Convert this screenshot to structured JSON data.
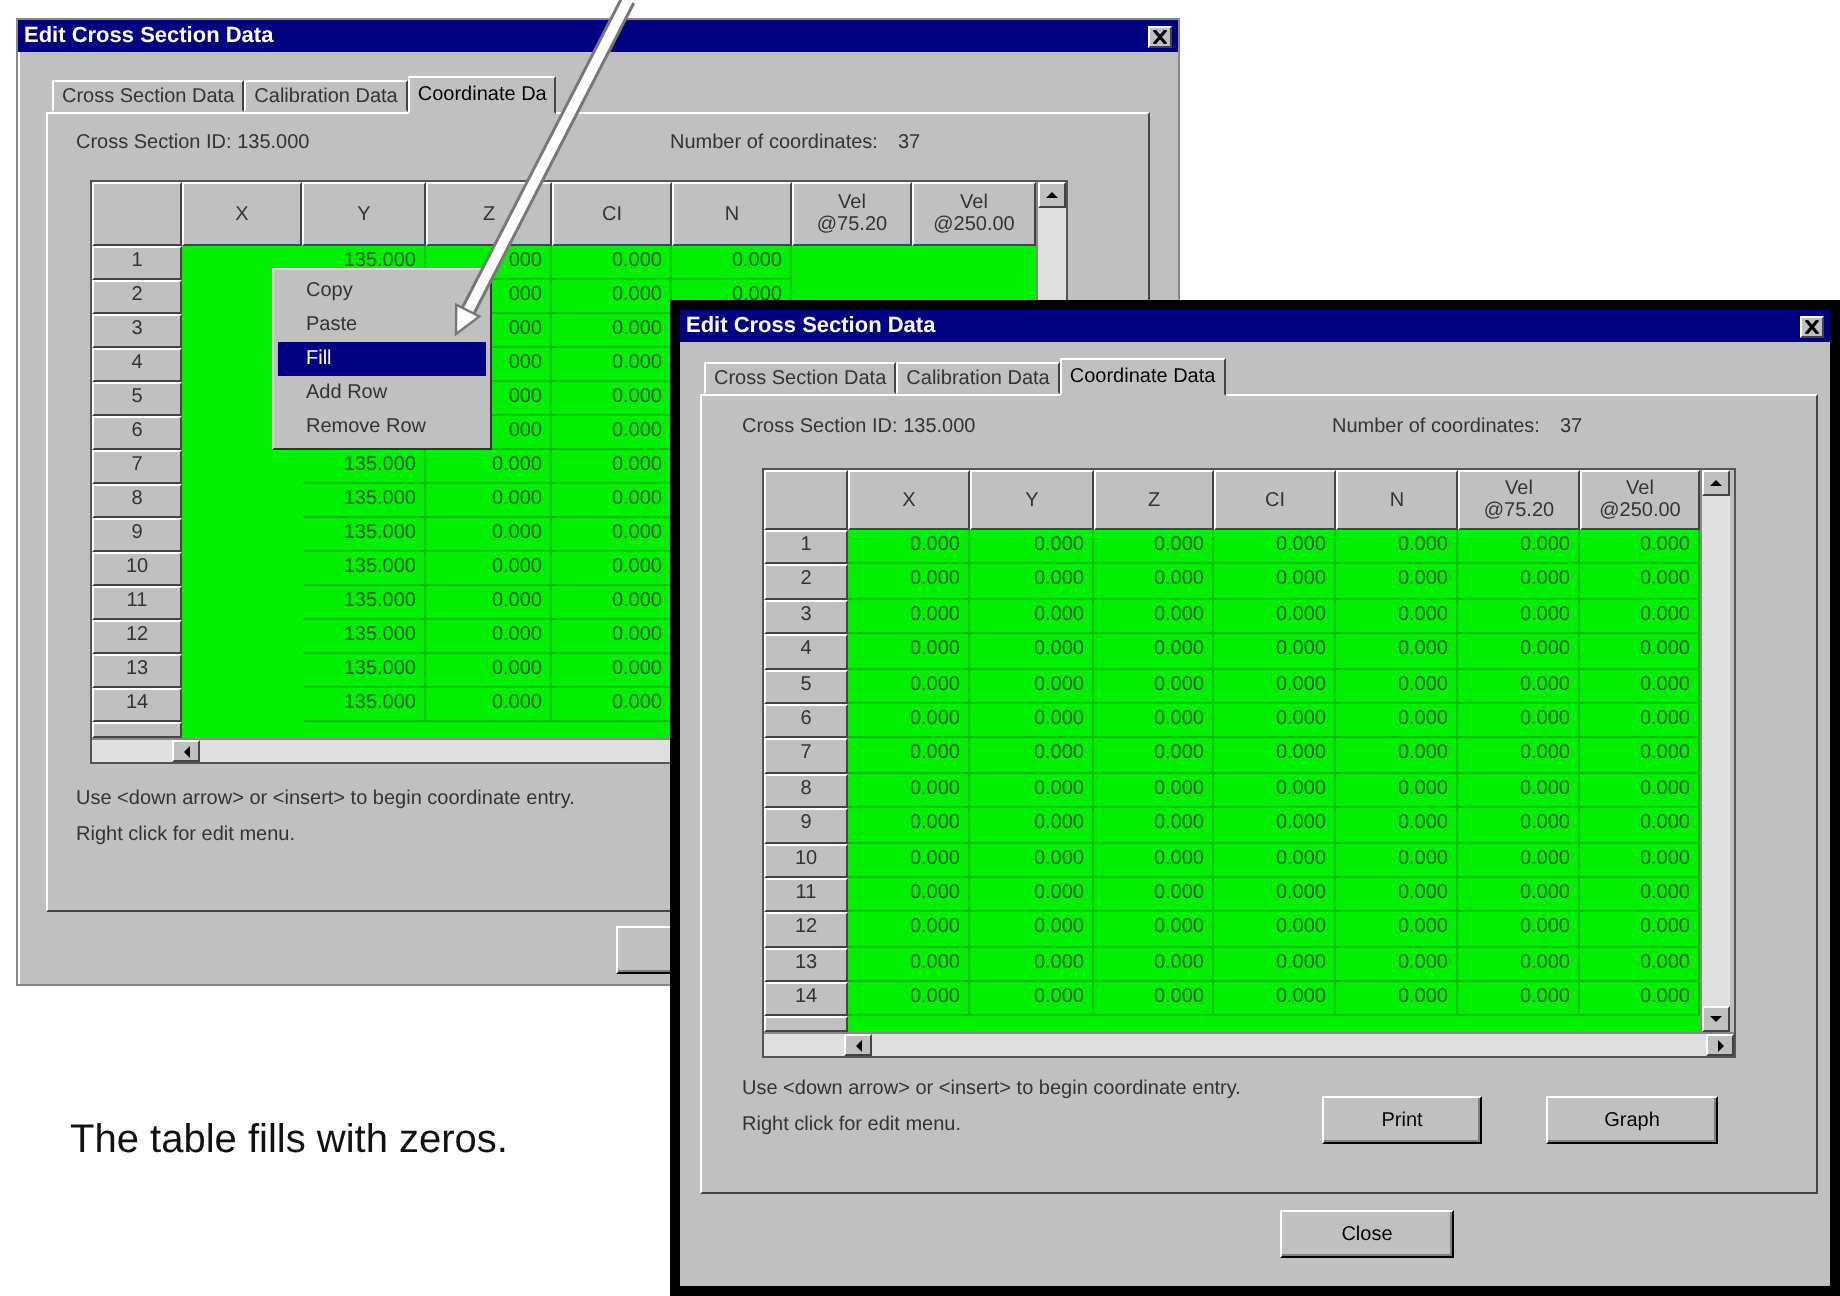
{
  "back_window": {
    "title": "Edit Cross Section Data",
    "tabs": [
      {
        "label": "Cross Section Data",
        "selected": false
      },
      {
        "label": "Calibration Data",
        "selected": false
      },
      {
        "label": "Coordinate Da",
        "selected": true
      }
    ],
    "cross_section_id": "Cross Section ID: 135.000",
    "coordinates_label": "Number of coordinates:",
    "coordinates_count": "37",
    "table": {
      "columns": [
        "X",
        "Y",
        "Z",
        "CI",
        "N",
        "Vel\n@75.20",
        "Vel\n@250.00"
      ],
      "rows": [
        {
          "number": "1",
          "cells": [
            null,
            "135.000",
            "000",
            "0.000",
            "0.000",
            null,
            null
          ]
        },
        {
          "number": "2",
          "cells": [
            null,
            null,
            "000",
            "0.000",
            "0.000",
            null,
            null
          ]
        },
        {
          "number": "3",
          "cells": [
            null,
            null,
            "000",
            "0.000",
            null,
            null,
            null
          ]
        },
        {
          "number": "4",
          "cells": [
            null,
            null,
            "000",
            "0.000",
            null,
            null,
            null
          ]
        },
        {
          "number": "5",
          "cells": [
            null,
            null,
            "000",
            "0.000",
            null,
            null,
            null
          ]
        },
        {
          "number": "6",
          "cells": [
            null,
            null,
            "000",
            "0.000",
            null,
            null,
            null
          ]
        },
        {
          "number": "7",
          "cells": [
            null,
            "135.000",
            "0.000",
            "0.000",
            null,
            null,
            null
          ]
        },
        {
          "number": "8",
          "cells": [
            null,
            "135.000",
            "0.000",
            "0.000",
            null,
            null,
            null
          ]
        },
        {
          "number": "9",
          "cells": [
            null,
            "135.000",
            "0.000",
            "0.000",
            null,
            null,
            null
          ]
        },
        {
          "number": "10",
          "cells": [
            null,
            "135.000",
            "0.000",
            "0.000",
            null,
            null,
            null
          ]
        },
        {
          "number": "11",
          "cells": [
            null,
            "135.000",
            "0.000",
            "0.000",
            null,
            null,
            null
          ]
        },
        {
          "number": "12",
          "cells": [
            null,
            "135.000",
            "0.000",
            "0.000",
            null,
            null,
            null
          ]
        },
        {
          "number": "13",
          "cells": [
            null,
            "135.000",
            "0.000",
            "0.000",
            null,
            null,
            null
          ]
        },
        {
          "number": "14",
          "cells": [
            null,
            "135.000",
            "0.000",
            "0.000",
            null,
            null,
            null
          ]
        }
      ]
    },
    "hints": [
      "Use <down arrow> or <insert> to begin coordinate entry.",
      "Right click for edit menu."
    ],
    "context_menu": {
      "items": [
        {
          "label": "Copy",
          "selected": false
        },
        {
          "label": "Paste",
          "selected": false
        },
        {
          "label": "Fill",
          "selected": true
        },
        {
          "label": "Add Row",
          "selected": false
        },
        {
          "label": "Remove Row",
          "selected": false
        }
      ]
    }
  },
  "front_window": {
    "title": "Edit Cross Section Data",
    "tabs": [
      {
        "label": "Cross Section Data",
        "selected": false
      },
      {
        "label": "Calibration Data",
        "selected": false
      },
      {
        "label": "Coordinate Data",
        "selected": true
      }
    ],
    "cross_section_id": "Cross Section ID: 135.000",
    "coordinates_label": "Number of coordinates:",
    "coordinates_count": "37",
    "table": {
      "columns": [
        "X",
        "Y",
        "Z",
        "CI",
        "N",
        "Vel\n@75.20",
        "Vel\n@250.00"
      ],
      "rows": [
        {
          "number": "1",
          "cells": [
            "0.000",
            "0.000",
            "0.000",
            "0.000",
            "0.000",
            "0.000",
            "0.000"
          ]
        },
        {
          "number": "2",
          "cells": [
            "0.000",
            "0.000",
            "0.000",
            "0.000",
            "0.000",
            "0.000",
            "0.000"
          ]
        },
        {
          "number": "3",
          "cells": [
            "0.000",
            "0.000",
            "0.000",
            "0.000",
            "0.000",
            "0.000",
            "0.000"
          ]
        },
        {
          "number": "4",
          "cells": [
            "0.000",
            "0.000",
            "0.000",
            "0.000",
            "0.000",
            "0.000",
            "0.000"
          ]
        },
        {
          "number": "5",
          "cells": [
            "0.000",
            "0.000",
            "0.000",
            "0.000",
            "0.000",
            "0.000",
            "0.000"
          ]
        },
        {
          "number": "6",
          "cells": [
            "0.000",
            "0.000",
            "0.000",
            "0.000",
            "0.000",
            "0.000",
            "0.000"
          ]
        },
        {
          "number": "7",
          "cells": [
            "0.000",
            "0.000",
            "0.000",
            "0.000",
            "0.000",
            "0.000",
            "0.000"
          ]
        },
        {
          "number": "8",
          "cells": [
            "0.000",
            "0.000",
            "0.000",
            "0.000",
            "0.000",
            "0.000",
            "0.000"
          ]
        },
        {
          "number": "9",
          "cells": [
            "0.000",
            "0.000",
            "0.000",
            "0.000",
            "0.000",
            "0.000",
            "0.000"
          ]
        },
        {
          "number": "10",
          "cells": [
            "0.000",
            "0.000",
            "0.000",
            "0.000",
            "0.000",
            "0.000",
            "0.000"
          ]
        },
        {
          "number": "11",
          "cells": [
            "0.000",
            "0.000",
            "0.000",
            "0.000",
            "0.000",
            "0.000",
            "0.000"
          ]
        },
        {
          "number": "12",
          "cells": [
            "0.000",
            "0.000",
            "0.000",
            "0.000",
            "0.000",
            "0.000",
            "0.000"
          ]
        },
        {
          "number": "13",
          "cells": [
            "0.000",
            "0.000",
            "0.000",
            "0.000",
            "0.000",
            "0.000",
            "0.000"
          ]
        },
        {
          "number": "14",
          "cells": [
            "0.000",
            "0.000",
            "0.000",
            "0.000",
            "0.000",
            "0.000",
            "0.000"
          ]
        }
      ]
    },
    "hints": [
      "Use <down arrow> or <insert> to begin coordinate entry.",
      "Right click for edit menu."
    ],
    "buttons": [
      "Print",
      "Graph"
    ],
    "close_button": "Close"
  },
  "caption": "The table fills with zeros."
}
